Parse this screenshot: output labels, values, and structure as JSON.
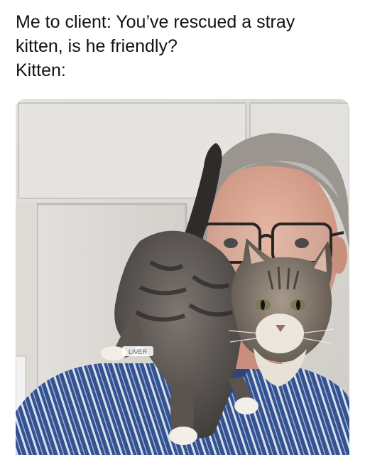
{
  "caption": {
    "lines": [
      "Me to client: You’ve rescued a stray",
      "kitten, is he friendly?",
      "Kitten:"
    ]
  },
  "photo": {
    "collar_tag": "LIVER"
  }
}
